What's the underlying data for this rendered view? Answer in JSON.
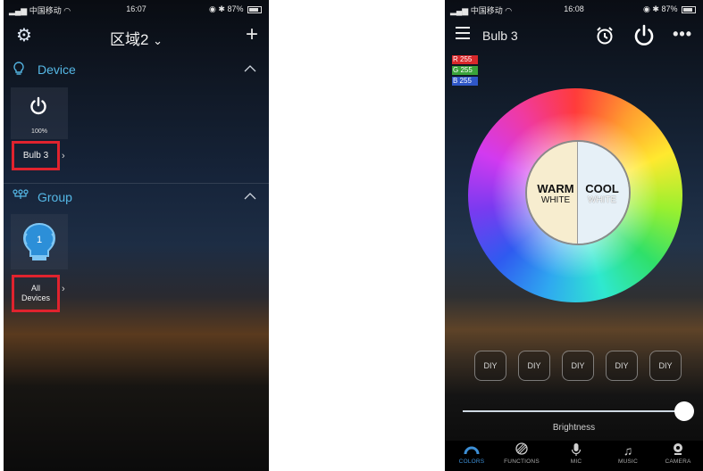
{
  "left_screen": {
    "status_bar": {
      "carrier": "中国移动",
      "time": "16:07",
      "battery": "87%"
    },
    "nav": {
      "title": "区域2",
      "title_chevron": "⌄",
      "add_label": "+"
    },
    "device_section": {
      "title": "Device",
      "chevron": "^"
    },
    "device_tile": {
      "percent": "100%",
      "name": "Bulb 3"
    },
    "group_section": {
      "title": "Group",
      "chevron": "^"
    },
    "group_tile": {
      "badge": "1",
      "name_line1": "All",
      "name_line2": "Devices"
    },
    "highlight_color": "#e0232e",
    "accent_color": "#55b8e6"
  },
  "right_screen": {
    "status_bar": {
      "carrier": "中国移动",
      "time": "16:08",
      "battery": "87%"
    },
    "nav": {
      "title": "Bulb 3",
      "more": "•••"
    },
    "rgb_readout": [
      {
        "text": "R 255",
        "color": "#d8282b"
      },
      {
        "text": "G 255",
        "color": "#3aa33a"
      },
      {
        "text": "B 255",
        "color": "#2f57c8"
      }
    ],
    "white_toggle": {
      "warm": {
        "title": "WARM",
        "subtitle": "WHITE"
      },
      "cool": {
        "title": "COOL",
        "subtitle": "WHITE"
      }
    },
    "diy_buttons": [
      "DIY",
      "DIY",
      "DIY",
      "DIY",
      "DIY"
    ],
    "brightness": {
      "label": "Brightness",
      "level_fraction": 1.0
    },
    "tabs": [
      {
        "label": "COLORS",
        "icon": "rainbow-icon",
        "active": true
      },
      {
        "label": "FUNCTIONS",
        "icon": "functions-icon",
        "active": false
      },
      {
        "label": "MIC",
        "icon": "mic-icon",
        "active": false
      },
      {
        "label": "MUSIC",
        "icon": "music-icon",
        "active": false
      },
      {
        "label": "CAMERA",
        "icon": "camera-icon",
        "active": false
      }
    ],
    "active_tab_color": "#3d8fd6"
  }
}
